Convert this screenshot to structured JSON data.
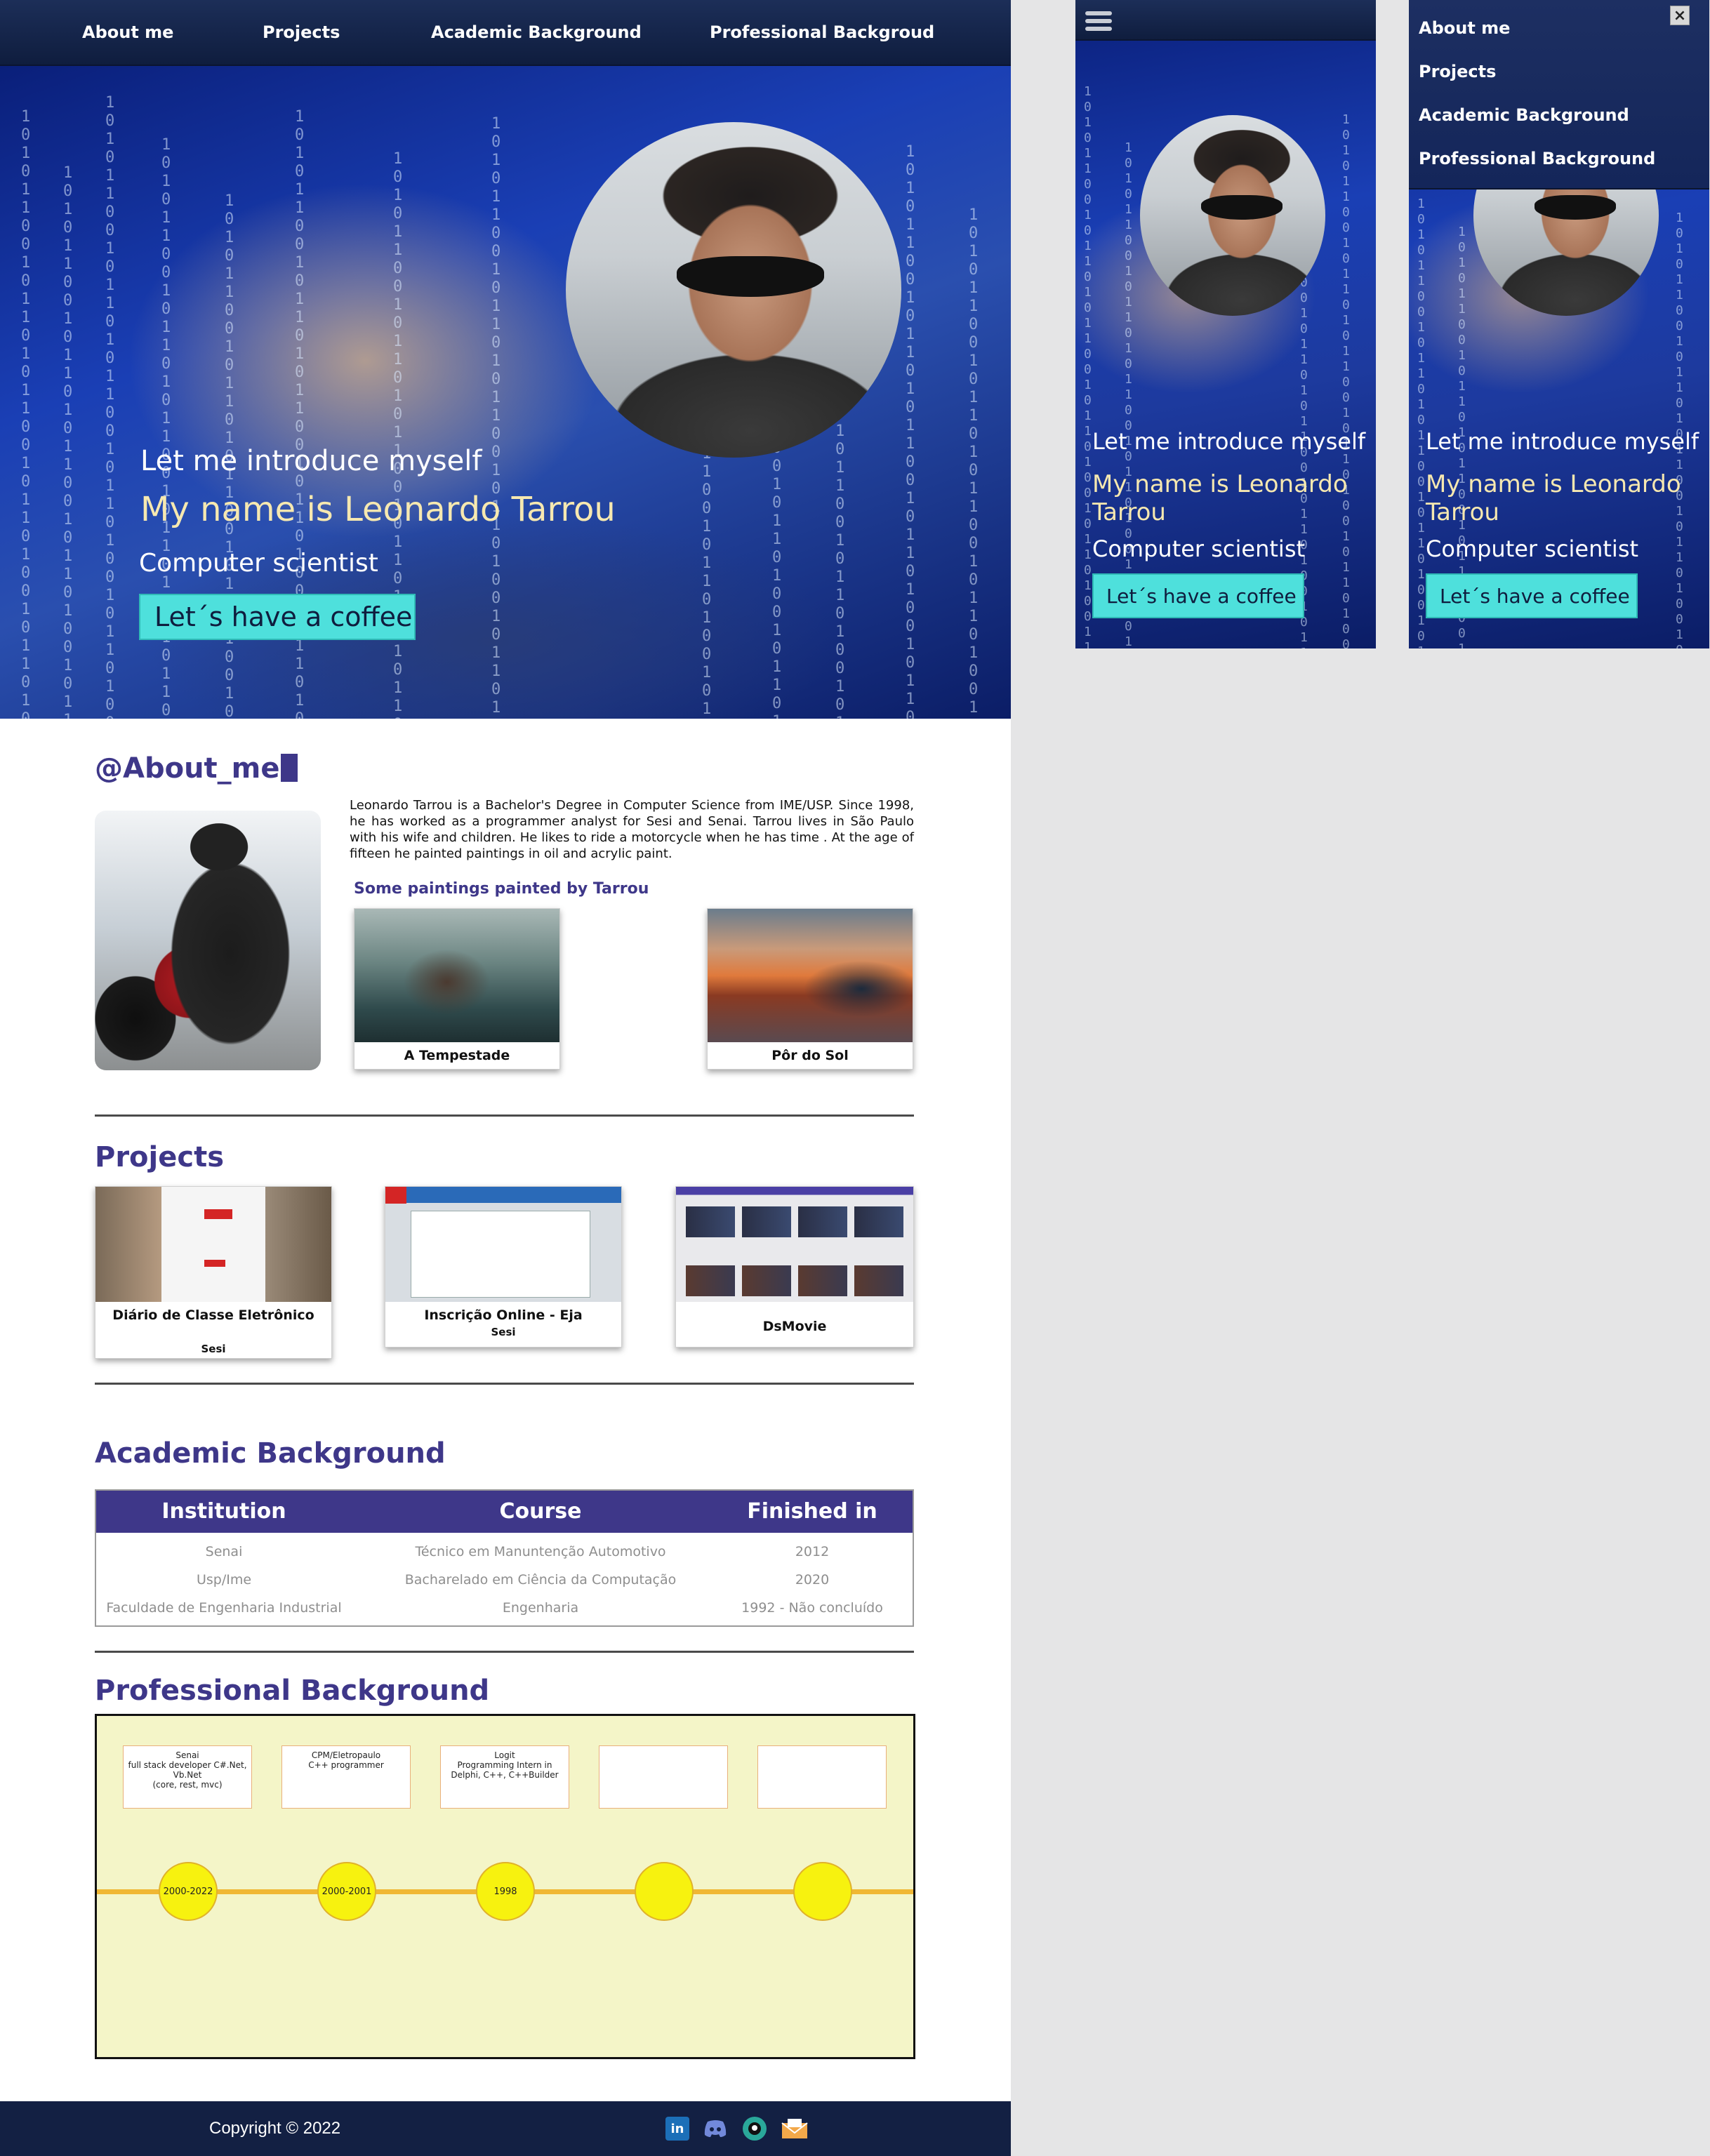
{
  "nav": {
    "about": "About me",
    "projects": "Projects",
    "academic": "Academic Background",
    "professional": "Professional Backgroud"
  },
  "mobile_menu": {
    "about": "About me",
    "projects": "Projects",
    "academic": "Academic Background",
    "professional": "Professional Background",
    "close": "×"
  },
  "hero": {
    "intro": "Let me introduce myself",
    "name": "My name is Leonardo Tarrou",
    "name_line1": "My name is Leonardo",
    "name_line2": "Tarrou",
    "role": "Computer scientist",
    "cta": "Let´s have a coffee",
    "binary": "1010110010110101100101101001011010011001011010010110100101"
  },
  "about": {
    "title": "@About_me",
    "text": "Leonardo Tarrou is a Bachelor's Degree in Computer Science from IME/USP. Since 1998, he has worked as a programmer analyst for Sesi and Senai. Tarrou lives in São Paulo with his wife and children. He likes to ride a motorcycle when he has time . At the age of fifteen he painted paintings in oil and acrylic paint.",
    "paintings_title": "Some paintings painted by Tarrou",
    "paintings": [
      {
        "caption": "A Tempestade"
      },
      {
        "caption": "Pôr do Sol"
      }
    ]
  },
  "projects": {
    "title": "Projects",
    "items": [
      {
        "caption": "Diário de Classe Eletrônico",
        "sub": "Sesi"
      },
      {
        "caption": "Inscrição Online - Eja",
        "sub": "Sesi"
      },
      {
        "caption": "DsMovie",
        "sub": ""
      }
    ]
  },
  "academic": {
    "title": "Academic Background",
    "headers": [
      "Institution",
      "Course",
      "Finished in"
    ],
    "rows": [
      [
        "Senai",
        "Técnico em  Manuntenção Automotivo",
        "2012"
      ],
      [
        "Usp/Ime",
        "Bacharelado em Ciência da Computação",
        "2020"
      ],
      [
        "Faculdade de Engenharia Industrial",
        "Engenharia",
        "1992 - Não concluído"
      ]
    ]
  },
  "professional": {
    "title": "Professional Background",
    "boxes": [
      {
        "l1": "Senai",
        "l2": "full stack developer C#.Net,",
        "l3": "Vb.Net",
        "l4": "(core, rest, mvc)"
      },
      {
        "l1": "CPM/Eletropaulo",
        "l2": "C++ programmer",
        "l3": "",
        "l4": ""
      },
      {
        "l1": "Logit",
        "l2": "Programming Intern in",
        "l3": "Delphi, C++, C++Builder",
        "l4": ""
      },
      {
        "l1": "",
        "l2": "",
        "l3": "",
        "l4": ""
      },
      {
        "l1": "",
        "l2": "",
        "l3": "",
        "l4": ""
      }
    ],
    "dots": [
      "2000-2022",
      "2000-2001",
      "1998",
      "",
      ""
    ]
  },
  "footer": {
    "copyright": "Copyright © 2022",
    "icons": [
      "linkedin-icon",
      "discord-icon",
      "github-icon",
      "email-icon"
    ],
    "linkedin_label": "in"
  },
  "colors": {
    "accent": "#3e3789",
    "nav_bg": "#132043",
    "cta": "#4ee0dc",
    "timeline_bg": "#f4f5c8",
    "timeline_line": "#f0b734",
    "timeline_dot": "#f7f20f"
  }
}
